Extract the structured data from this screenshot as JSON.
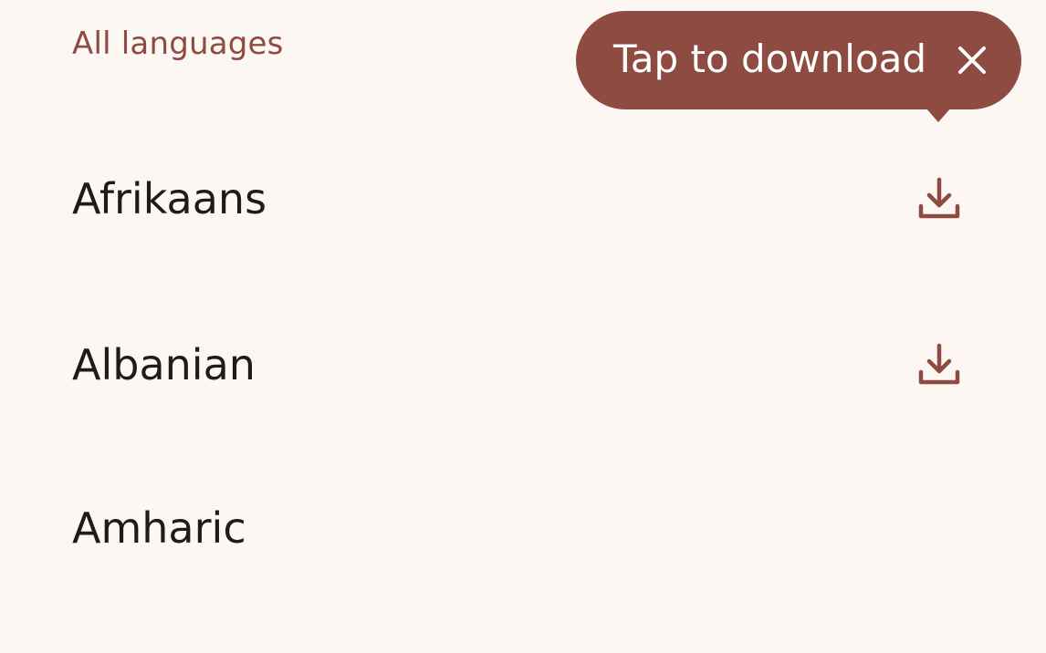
{
  "list": {
    "section_header": "All languages",
    "items": [
      {
        "label": "Afrikaans",
        "action_icon": "download-icon"
      },
      {
        "label": "Albanian",
        "action_icon": "download-icon"
      },
      {
        "label": "Amharic",
        "action_icon": null
      }
    ]
  },
  "tooltip": {
    "text": "Tap to download",
    "close_icon": "close-icon"
  },
  "colors": {
    "background": "#fdf7f4",
    "accent": "#8d4b41",
    "text_primary": "#221a18",
    "tooltip_text": "#ffffff"
  }
}
